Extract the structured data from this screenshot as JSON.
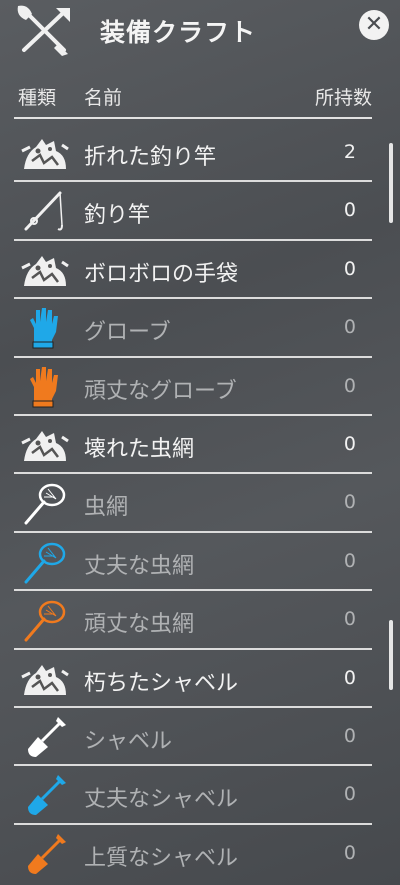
{
  "header": {
    "title": "装備クラフト",
    "icon": "crossed-tools-icon",
    "close_icon": "close-icon"
  },
  "columns": {
    "type": "種類",
    "name": "名前",
    "count": "所持数"
  },
  "items": [
    {
      "name": "折れた釣り竿",
      "count": "2",
      "icon": "broken-pile-icon",
      "enabled": true
    },
    {
      "name": "釣り竿",
      "count": "0",
      "icon": "fishing-rod-icon",
      "enabled": true
    },
    {
      "name": "ボロボロの手袋",
      "count": "0",
      "icon": "broken-pile-icon",
      "enabled": true
    },
    {
      "name": "グローブ",
      "count": "0",
      "icon": "glove-icon",
      "color": "#1fa8e8",
      "enabled": false
    },
    {
      "name": "頑丈なグローブ",
      "count": "0",
      "icon": "glove-icon",
      "color": "#f07a1e",
      "enabled": false
    },
    {
      "name": "壊れた虫網",
      "count": "0",
      "icon": "broken-pile-icon",
      "enabled": true
    },
    {
      "name": "虫網",
      "count": "0",
      "icon": "bug-net-icon",
      "color": "#ffffff",
      "enabled": false
    },
    {
      "name": "丈夫な虫網",
      "count": "0",
      "icon": "bug-net-icon",
      "color": "#1fa8e8",
      "enabled": false
    },
    {
      "name": "頑丈な虫網",
      "count": "0",
      "icon": "bug-net-icon",
      "color": "#f07a1e",
      "enabled": false
    },
    {
      "name": "朽ちたシャベル",
      "count": "0",
      "icon": "broken-pile-icon",
      "enabled": true
    },
    {
      "name": "シャベル",
      "count": "0",
      "icon": "shovel-icon",
      "color": "#ffffff",
      "enabled": false
    },
    {
      "name": "丈夫なシャベル",
      "count": "0",
      "icon": "shovel-icon",
      "color": "#1fa8e8",
      "enabled": false
    },
    {
      "name": "上質なシャベル",
      "count": "0",
      "icon": "shovel-icon",
      "color": "#f07a1e",
      "enabled": false
    }
  ]
}
